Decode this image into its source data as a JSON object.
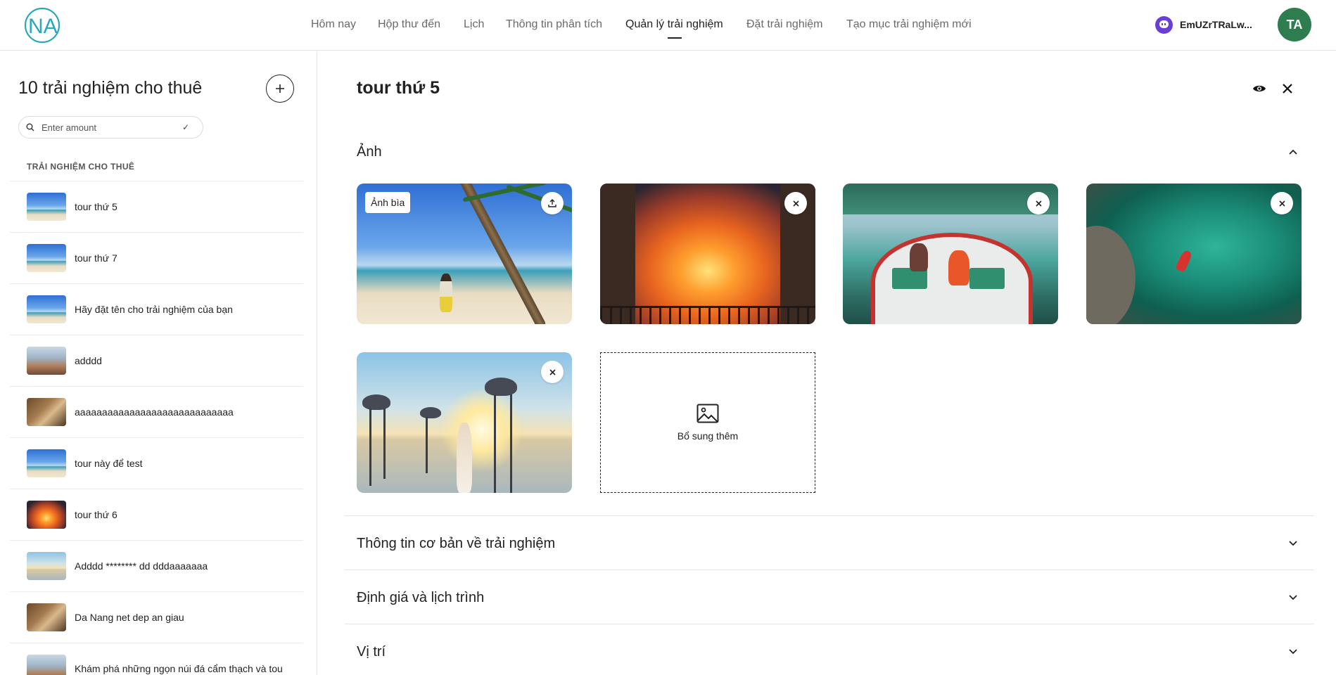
{
  "header": {
    "logo_text": "NA",
    "nav": [
      {
        "label": "Hôm nay"
      },
      {
        "label": "Hộp thư đến"
      },
      {
        "label": "Lịch"
      },
      {
        "label": "Thông tin phân tích"
      },
      {
        "label": "Quản lý trải nghiệm"
      },
      {
        "label": "Đặt trải nghiệm"
      },
      {
        "label": "Tạo mục trải nghiệm mới"
      }
    ],
    "active_nav": "Quản lý trải nghiệm",
    "host_name": "EmUZrTRaLw...",
    "avatar_initials": "TA",
    "colors": {
      "logo": "#2aa7b8",
      "avatar_bg": "#2e7d4f",
      "host_icon": "#6a3fd8"
    }
  },
  "sidebar": {
    "title": "10 trải nghiệm cho thuê",
    "search_placeholder": "Enter amount",
    "section_label": "TRẢI NGHIỆM CHO THUÊ",
    "items": [
      {
        "label": "tour thứ 5",
        "thumb": "beach"
      },
      {
        "label": "tour thứ 7",
        "thumb": "beach"
      },
      {
        "label": "Hãy đặt tên cho trải nghiệm của bạn",
        "thumb": "beach"
      },
      {
        "label": "adddd",
        "thumb": "mount"
      },
      {
        "label": "aaaaaaaaaaaaaaaaaaaaaaaaaaaaa",
        "thumb": "brown"
      },
      {
        "label": "tour này để test",
        "thumb": "beach"
      },
      {
        "label": "tour thứ 6",
        "thumb": "sunset"
      },
      {
        "label": "Adddd ******** dd dddaaaaaaa",
        "thumb": "eleph"
      },
      {
        "label": "Da Nang net dep an giau",
        "thumb": "brown"
      },
      {
        "label": "Khám phá những ngọn núi đá cẩm thạch và tou",
        "thumb": "mount"
      }
    ]
  },
  "main": {
    "title": "tour thứ 5",
    "photos_section": {
      "title": "Ảnh",
      "cover_badge": "Ảnh bìa",
      "photos": [
        "beach",
        "sunset",
        "boat",
        "reef",
        "eleph"
      ],
      "add_more_label": "Bổ sung thêm"
    },
    "sections": [
      {
        "title": "Thông tin cơ bản về trải nghiệm"
      },
      {
        "title": "Định giá và lịch trình"
      },
      {
        "title": "Vị trí"
      }
    ]
  }
}
